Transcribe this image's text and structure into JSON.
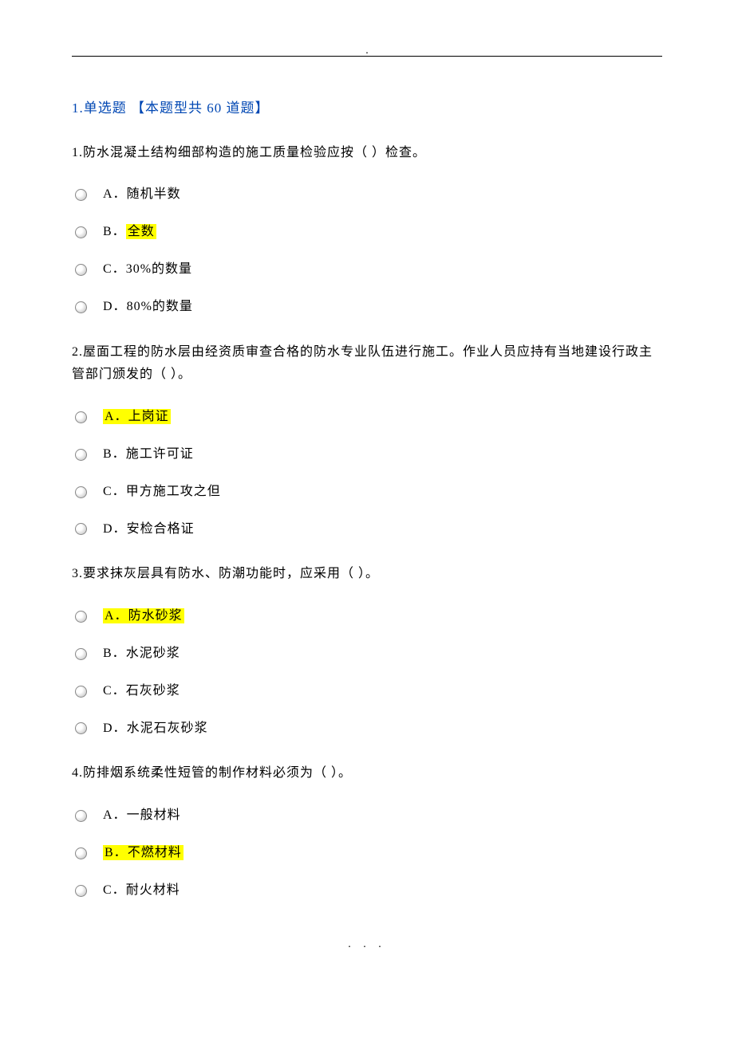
{
  "section_title": "1.单选题 【本题型共 60 道题】",
  "questions": [
    {
      "text": "1.防水混凝土结构细部构造的施工质量检验应按（  ）检查。",
      "options": [
        {
          "prefix": "A．",
          "text": "随机半数",
          "highlight_text": false,
          "highlight_prefix": false
        },
        {
          "prefix": "B．",
          "text": "全数",
          "highlight_text": true,
          "highlight_prefix": false
        },
        {
          "prefix": "C．",
          "text": "30%的数量",
          "highlight_text": false,
          "highlight_prefix": false
        },
        {
          "prefix": "D．",
          "text": "80%的数量",
          "highlight_text": false,
          "highlight_prefix": false
        }
      ]
    },
    {
      "text": "2.屋面工程的防水层由经资质审查合格的防水专业队伍进行施工。作业人员应持有当地建设行政主管部门颁发的（  ）。",
      "options": [
        {
          "prefix": "A．",
          "text": "上岗证",
          "highlight_text": true,
          "highlight_prefix": true
        },
        {
          "prefix": "B．",
          "text": "施工许可证",
          "highlight_text": false,
          "highlight_prefix": false
        },
        {
          "prefix": "C．",
          "text": "甲方施工攻之但",
          "highlight_text": false,
          "highlight_prefix": false
        },
        {
          "prefix": "D．",
          "text": "安检合格证",
          "highlight_text": false,
          "highlight_prefix": false
        }
      ]
    },
    {
      "text": "3.要求抹灰层具有防水、防潮功能时，应采用（  ）。",
      "options": [
        {
          "prefix": "A．",
          "text": "防水砂浆",
          "highlight_text": true,
          "highlight_prefix": true
        },
        {
          "prefix": "B．",
          "text": "水泥砂浆",
          "highlight_text": false,
          "highlight_prefix": false
        },
        {
          "prefix": "C．",
          "text": "石灰砂浆",
          "highlight_text": false,
          "highlight_prefix": false
        },
        {
          "prefix": "D．",
          "text": "水泥石灰砂浆",
          "highlight_text": false,
          "highlight_prefix": false
        }
      ]
    },
    {
      "text": "4.防排烟系统柔性短管的制作材料必须为（  ）。",
      "options": [
        {
          "prefix": "A．",
          "text": "一般材料",
          "highlight_text": false,
          "highlight_prefix": false
        },
        {
          "prefix": "B．",
          "text": "不燃材料",
          "highlight_text": true,
          "highlight_prefix": true
        },
        {
          "prefix": "C．",
          "text": "耐火材料",
          "highlight_text": false,
          "highlight_prefix": false
        }
      ]
    }
  ],
  "footer": ". . ."
}
